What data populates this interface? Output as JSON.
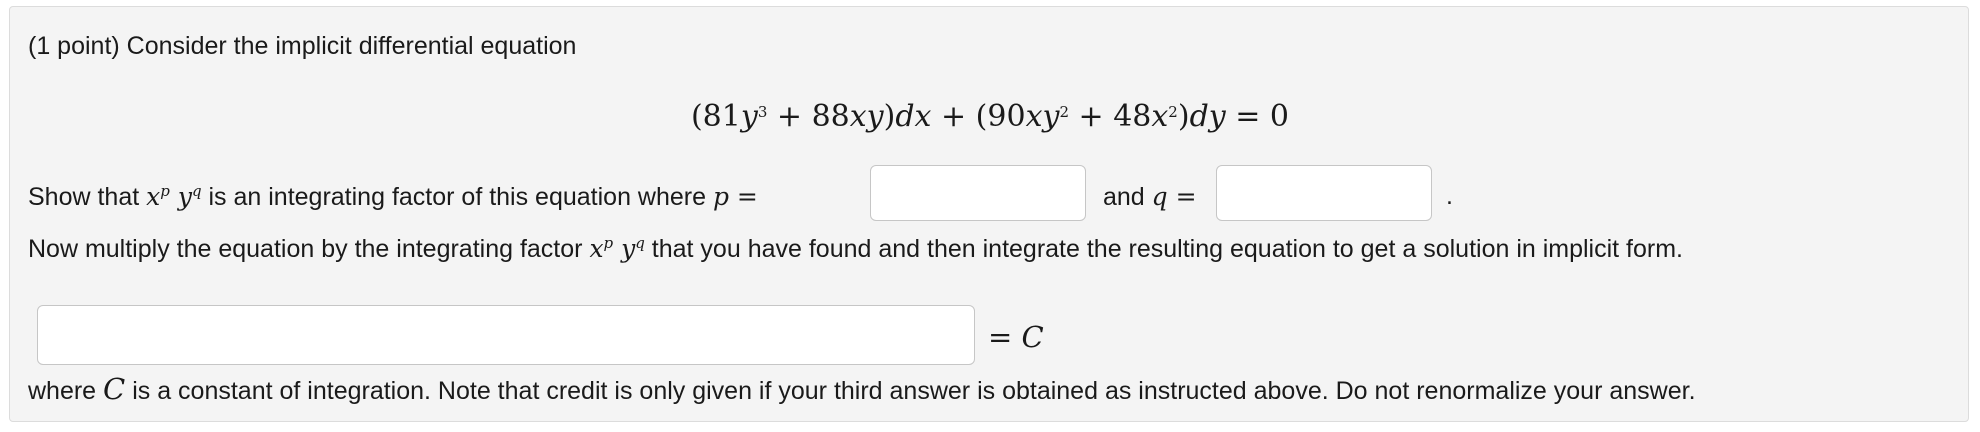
{
  "problem": {
    "header": "(1 point) Consider the implicit differential equation",
    "equation": {
      "part1": "(81",
      "part2": " + 88",
      "part3": ")",
      "part4": " + (90",
      "part5": " + 48",
      "part6": ")",
      "part7": " = 0",
      "y": "y",
      "x": "x",
      "xy": "xy",
      "dx": "dx",
      "dy": "dy",
      "exp3": "3",
      "exp2": "2"
    },
    "line1": {
      "show_that": "Show that ",
      "x": "x",
      "p_sup": "p",
      "y": "y",
      "q_sup": "q",
      "middle": " is an integrating factor of this equation where ",
      "p": "p",
      "equals1": " =",
      "and_text": "and ",
      "q": "q",
      "equals2": " =",
      "period": "."
    },
    "line2": {
      "before": "Now multiply the equation by the integrating factor ",
      "x": "x",
      "p_sup": "p",
      "y": "y",
      "q_sup": "q",
      "after": " that you have found and then integrate the resulting equation to get a solution in implicit form."
    },
    "answer_suffix": {
      "equals": "= ",
      "c": "C"
    },
    "line3": {
      "where": "where ",
      "c": "C",
      "after": " is a constant of integration. Note that credit is only given if your third answer is obtained as instructed above. Do not renormalize your answer."
    },
    "inputs": {
      "p_value": "",
      "q_value": "",
      "implicit_solution_value": ""
    }
  }
}
